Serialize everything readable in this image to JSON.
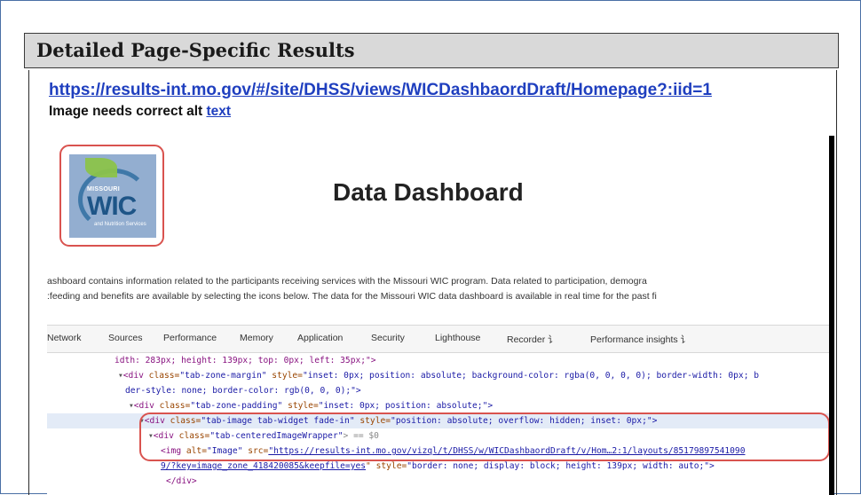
{
  "section": {
    "title": "Detailed Page-Specific Results"
  },
  "issue": {
    "url": "https://results-int.mo.gov/#/site/DHSS/views/WICDashbaordDraft/Homepage?:iid=1",
    "title_prefix": "Image needs correct alt ",
    "title_link": "text"
  },
  "screenshot": {
    "logo": {
      "state": "MISSOURI",
      "name": "WIC",
      "subtitle": "and Nutrition Services"
    },
    "dashboard_title": "Data Dashboard",
    "description_line1": "ashboard contains information related to the participants receiving services with the Missouri WIC program. Data related to participation, demogra",
    "description_line2": ":feeding and benefits are available by selecting the icons below. The data for the Missouri WIC data dashboard is available in real time for the past fi",
    "devtools_tabs": [
      "Network",
      "Sources",
      "Performance",
      "Memory",
      "Application",
      "Security",
      "Lighthouse",
      "Recorder ⻈",
      "Performance insights ⻈"
    ],
    "code": {
      "l1": "idth: 283px; height: 139px; top: 0px; left: 35px;\">",
      "l2_tag": "<div",
      "l2_attr1": " class=",
      "l2_val1": "\"tab-zone-margin\"",
      "l2_attr2": " style=",
      "l2_val2": "\"inset: 0px; position: absolute; background-color: rgba(0, 0, 0, 0); border-width: 0px; b",
      "l3": "der-style: none; border-color: rgb(0, 0, 0);\">",
      "l4_tag": "<div",
      "l4_attr1": " class=",
      "l4_val1": "\"tab-zone-padding\"",
      "l4_attr2": " style=",
      "l4_val2": "\"inset: 0px; position: absolute;\">",
      "l5_tag": "<div",
      "l5_attr1": " class=",
      "l5_val1": "\"tab-image tab-widget fade-in\"",
      "l5_attr2": " style=",
      "l5_val2": "\"position: absolute; overflow: hidden; inset: 0px;\">",
      "l6_tag": "<div",
      "l6_attr1": " class=",
      "l6_val1": "\"tab-centeredImageWrapper\"",
      "l6_tail": "> == $0",
      "l7_tag": "<img",
      "l7_attr1": " alt=",
      "l7_val1": "\"Image\"",
      "l7_attr2": " src=",
      "l7_url": "\"https://results-int.mo.gov/vizql/t/DHSS/w/WICDashbaordDraft/v/Hom…2:1/layouts/85179897541090",
      "l8_url": "9/?key=image_zone_418420085&keepfile=yes",
      "l8_attr": "\" style=",
      "l8_val": "\"border: none; display: block; height: 139px; width: auto;\">",
      "l9": "</div>"
    }
  }
}
